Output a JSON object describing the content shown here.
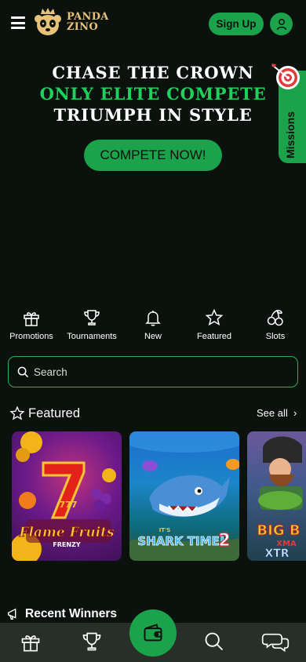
{
  "header": {
    "logo_line1": "PANDA",
    "logo_line2": "ZINO",
    "signup_label": "Sign Up"
  },
  "hero": {
    "line1": "CHASE THE CROWN",
    "line2": "ONLY ELITE COMPETE",
    "line3": "TRIUMPH IN STYLE",
    "cta_label": "COMPETE NOW!"
  },
  "missions": {
    "label": "Missions"
  },
  "categories": [
    {
      "label": "Promotions",
      "icon": "gift-icon"
    },
    {
      "label": "Tournaments",
      "icon": "trophy-icon"
    },
    {
      "label": "New",
      "icon": "bell-icon"
    },
    {
      "label": "Featured",
      "icon": "star-icon"
    },
    {
      "label": "Slots",
      "icon": "cherries-icon"
    }
  ],
  "search": {
    "placeholder": "Search"
  },
  "featured": {
    "title": "Featured",
    "see_all": "See all",
    "games": [
      {
        "title_main": "Flame Fruits",
        "title_sub": "FRENZY",
        "badge": "777"
      },
      {
        "title_prefix": "IT'S",
        "title_main": "SHARK TIME!",
        "title_num": "2"
      },
      {
        "title_main": "BIG B",
        "title_sub": "XMA",
        "title_sub2": "XTR"
      }
    ]
  },
  "winners": {
    "title": "Recent Winners"
  },
  "bottom_nav": [
    {
      "icon": "gift-icon"
    },
    {
      "icon": "trophy-icon"
    },
    {
      "icon": "wallet-icon"
    },
    {
      "icon": "search-icon"
    },
    {
      "icon": "chat-icon"
    }
  ],
  "colors": {
    "background": "#0b120d",
    "accent": "#1aa34a",
    "accent_text": "#1fd15c",
    "logo_gold": "#e7c27a",
    "nav_bar": "#263028"
  }
}
